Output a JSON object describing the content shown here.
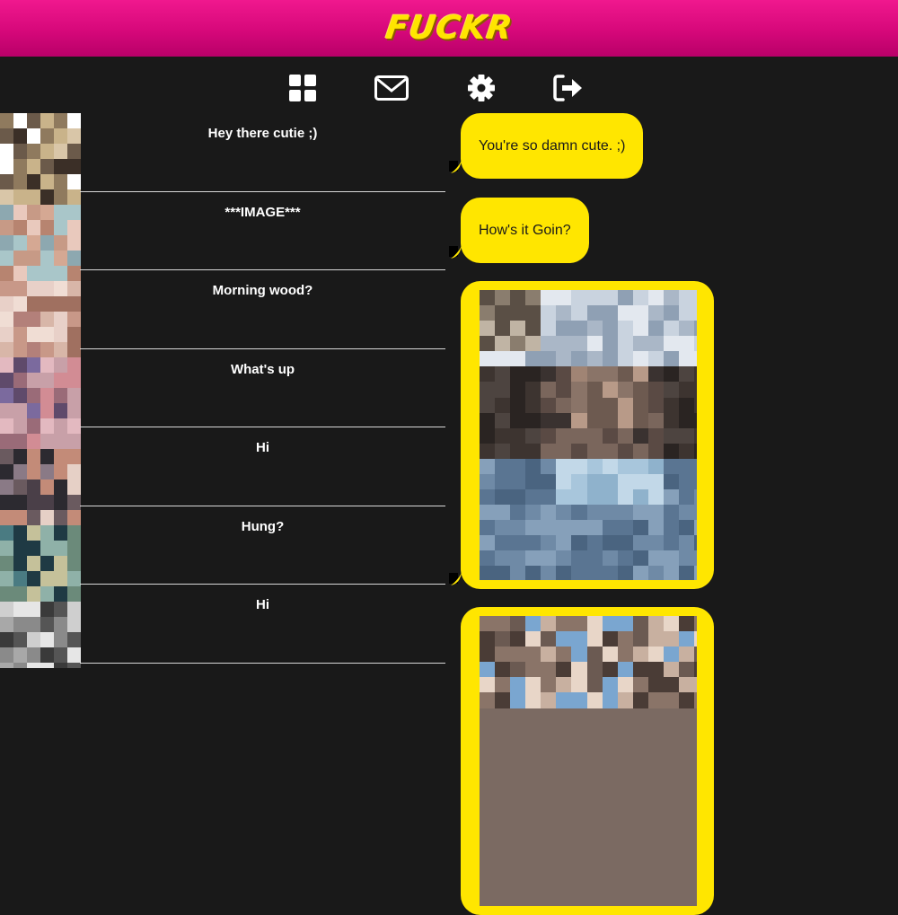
{
  "header": {
    "logo_text": "FUCKR",
    "brand_color": "#e8107f",
    "accent_color": "#ffe600"
  },
  "nav": {
    "icons": [
      "grid-icon",
      "mail-icon",
      "gear-icon",
      "logout-icon"
    ]
  },
  "conversations": [
    {
      "preview": "Hey there cutie ;)"
    },
    {
      "preview": "***IMAGE***"
    },
    {
      "preview": "Morning wood?"
    },
    {
      "preview": "What's up"
    },
    {
      "preview": "Hi"
    },
    {
      "preview": "Hung?"
    },
    {
      "preview": "Hi"
    }
  ],
  "messages": [
    {
      "type": "text",
      "text": "You're so damn cute. ;)"
    },
    {
      "type": "text",
      "text": "How's it Goin?"
    },
    {
      "type": "image"
    },
    {
      "type": "image"
    }
  ]
}
